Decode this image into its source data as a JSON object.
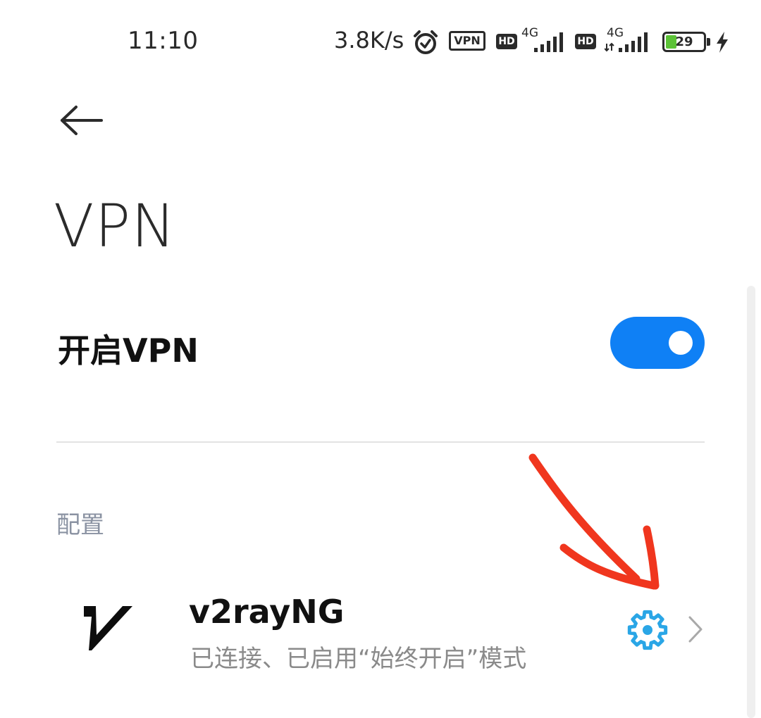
{
  "status_bar": {
    "time": "11:10",
    "net_speed": "3.8K/s",
    "vpn_badge": "VPN",
    "hd_badge": "HD",
    "network_type": "4G",
    "battery_percent": 29,
    "battery_text": "29",
    "charging": true
  },
  "header": {
    "title": "VPN"
  },
  "vpn_toggle": {
    "label": "开启VPN",
    "on": true
  },
  "profiles": {
    "section_title": "配置",
    "items": [
      {
        "name": "v2rayNG",
        "status": "已连接、已启用“始终开启”模式"
      }
    ]
  },
  "colors": {
    "accent": "#0f80f5",
    "gear": "#2aa6e6",
    "annotation": "#f0361e",
    "battery": "#5bc236"
  },
  "icons": {
    "back": "back-arrow-icon",
    "alarm": "alarm-clock-icon",
    "signal": "signal-strength-icon",
    "charging": "lightning-bolt-icon",
    "app": "v2rayng-logo",
    "settings": "gear-icon",
    "chevron": "chevron-right-icon"
  }
}
